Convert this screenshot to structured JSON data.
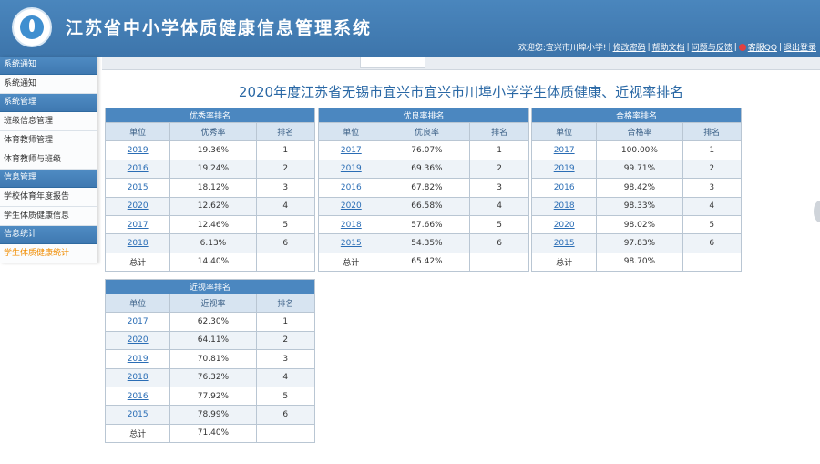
{
  "header": {
    "title": "江苏省中小学体质健康信息管理系统",
    "welcome": "欢迎您:宜兴市川埠小学!",
    "links": [
      "修改密码",
      "帮助文档",
      "问题与反馈",
      "客服QQ",
      "退出登录"
    ]
  },
  "sidebar": [
    {
      "type": "head",
      "label": "系统通知"
    },
    {
      "type": "item",
      "label": "系统通知"
    },
    {
      "type": "head",
      "label": "系统管理"
    },
    {
      "type": "item",
      "label": "班级信息管理"
    },
    {
      "type": "item",
      "label": "体育教师管理"
    },
    {
      "type": "item",
      "label": "体育教师与班级"
    },
    {
      "type": "head",
      "label": "信息管理"
    },
    {
      "type": "item",
      "label": "学校体育年度报告"
    },
    {
      "type": "item",
      "label": "学生体质健康信息"
    },
    {
      "type": "head",
      "label": "信息统计"
    },
    {
      "type": "item",
      "label": "学生体质健康统计",
      "active": true
    }
  ],
  "page_title": "2020年度江苏省无锡市宜兴市宜兴市川埠小学学生体质健康、近视率排名",
  "tables": [
    {
      "id": "excellent",
      "caption": "优秀率排名",
      "columns": [
        "单位",
        "优秀率",
        "排名"
      ],
      "rows": [
        [
          "2019",
          "19.36%",
          "1"
        ],
        [
          "2016",
          "19.24%",
          "2"
        ],
        [
          "2015",
          "18.12%",
          "3"
        ],
        [
          "2020",
          "12.62%",
          "4"
        ],
        [
          "2017",
          "12.46%",
          "5"
        ],
        [
          "2018",
          "6.13%",
          "6"
        ]
      ],
      "total": [
        "总计",
        "14.40%",
        ""
      ]
    },
    {
      "id": "good",
      "caption": "优良率排名",
      "columns": [
        "单位",
        "优良率",
        "排名"
      ],
      "rows": [
        [
          "2017",
          "76.07%",
          "1"
        ],
        [
          "2019",
          "69.36%",
          "2"
        ],
        [
          "2016",
          "67.82%",
          "3"
        ],
        [
          "2020",
          "66.58%",
          "4"
        ],
        [
          "2018",
          "57.66%",
          "5"
        ],
        [
          "2015",
          "54.35%",
          "6"
        ]
      ],
      "total": [
        "总计",
        "65.42%",
        ""
      ]
    },
    {
      "id": "pass",
      "caption": "合格率排名",
      "columns": [
        "单位",
        "合格率",
        "排名"
      ],
      "rows": [
        [
          "2017",
          "100.00%",
          "1"
        ],
        [
          "2019",
          "99.71%",
          "2"
        ],
        [
          "2016",
          "98.42%",
          "3"
        ],
        [
          "2018",
          "98.33%",
          "4"
        ],
        [
          "2020",
          "98.02%",
          "5"
        ],
        [
          "2015",
          "97.83%",
          "6"
        ]
      ],
      "total": [
        "总计",
        "98.70%",
        ""
      ]
    },
    {
      "id": "myopia",
      "caption": "近视率排名",
      "columns": [
        "单位",
        "近视率",
        "排名"
      ],
      "rows": [
        [
          "2017",
          "62.30%",
          "1"
        ],
        [
          "2020",
          "64.11%",
          "2"
        ],
        [
          "2019",
          "70.81%",
          "3"
        ],
        [
          "2018",
          "76.32%",
          "4"
        ],
        [
          "2016",
          "77.92%",
          "5"
        ],
        [
          "2015",
          "78.99%",
          "6"
        ]
      ],
      "total": [
        "总计",
        "71.40%",
        ""
      ]
    }
  ]
}
